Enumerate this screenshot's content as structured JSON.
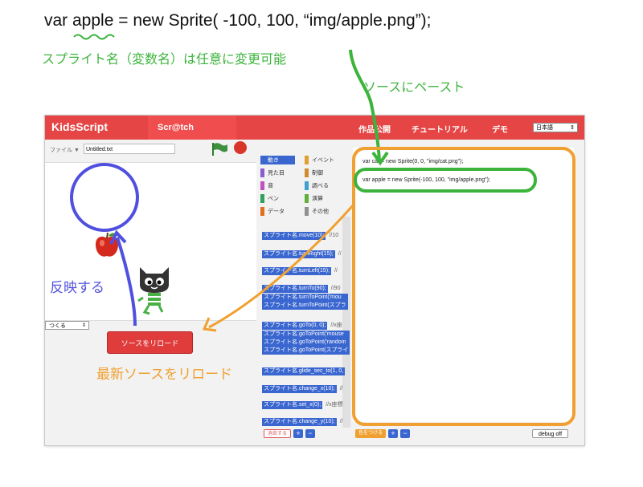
{
  "annotations": {
    "code_line": "var apple = new Sprite( -100, 100, “img/apple.png”);",
    "sprite_name_note": "スプライト名（変数名）は任意に変更可能",
    "paste_note": "ソースにペースト",
    "reflect_note": "反映する",
    "reload_note": "最新ソースをリロード"
  },
  "header": {
    "logo": "KidsScript",
    "tab": "Scr@tch",
    "nav": [
      "作品公開",
      "チュートリアル",
      "デモ"
    ],
    "language": "日本語"
  },
  "file": {
    "label": "ファイル ▼",
    "filename": "Untitled.txt"
  },
  "stage": {
    "make_select": "つくる",
    "reload_button": "ソースをリロード"
  },
  "categories": [
    {
      "label": "動き",
      "color": "#3a66d0"
    },
    {
      "label": "イベント",
      "color": "#e0a030"
    },
    {
      "label": "見た目",
      "color": "#8a5ad0"
    },
    {
      "label": "制御",
      "color": "#d08a30"
    },
    {
      "label": "音",
      "color": "#c050c0"
    },
    {
      "label": "調べる",
      "color": "#40a0d0"
    },
    {
      "label": "ペン",
      "color": "#30a060"
    },
    {
      "label": "演算",
      "color": "#60b040"
    },
    {
      "label": "データ",
      "color": "#e07020"
    },
    {
      "label": "その他",
      "color": "#909090"
    }
  ],
  "blocks": [
    {
      "code": "スプライト名.move(10);",
      "comment": "//10"
    },
    {
      "code": "スプライト名.turnRight(15);",
      "comment": "//"
    },
    {
      "code": "スプライト名.turnLeft(15);",
      "comment": "//"
    },
    {
      "code": "スプライト名.turnTo(90);",
      "comment": "//90"
    },
    {
      "lines": [
        "スプライト名.turnToPoint('mou",
        "スプライト名.turnToPoint(スプラ"
      ]
    },
    {
      "code": "スプライト名.goTo(0, 0);",
      "comment": "//x座"
    },
    {
      "lines": [
        "スプライト名.goToPoint('mouse",
        "スプライト名.goToPoint('random",
        "スプライト名.goToPoint(スプライ"
      ]
    },
    {
      "code": "スプライト名.glide_sec_to(1, 0,",
      "comment": ""
    },
    {
      "code": "スプライト名.change_x(10);",
      "comment": "//"
    },
    {
      "code": "スプライト名.set_x(0);",
      "comment": "//x座標"
    },
    {
      "code": "スプライト名.change_y(10);",
      "comment": "//"
    }
  ],
  "editor": {
    "lines": [
      "var cat = new Sprite(0, 0, \"img/cat.png\");",
      "var apple = new Sprite(-100, 100, \"img/apple.png\");"
    ]
  },
  "bottom": {
    "left_button": "消去する",
    "right_button": "色をつける",
    "plus": "+",
    "minus": "−",
    "debug_button": "debug off"
  },
  "colors": {
    "header": "#e64545",
    "accent_green": "#3cb43c",
    "accent_blue": "#5555dd",
    "accent_orange": "#f0a030",
    "block": "#3a66d0"
  }
}
